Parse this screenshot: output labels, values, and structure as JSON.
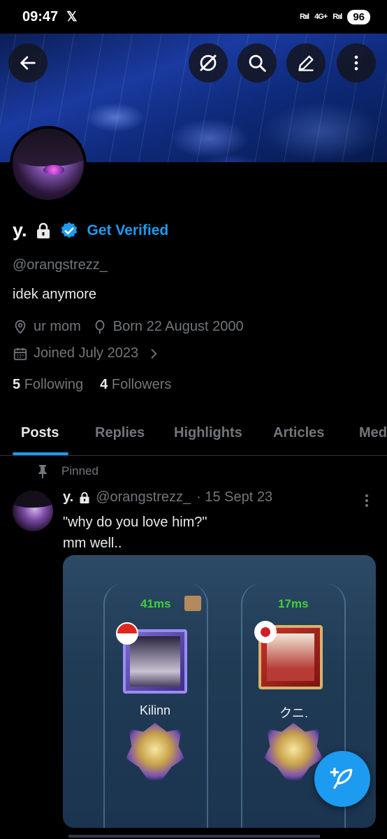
{
  "status_bar": {
    "time": "09:47",
    "notification_icon": "x-logo-icon",
    "signal_left": "Rııl",
    "network": "4G+",
    "signal_right": "Rııl",
    "battery": "96"
  },
  "top_bar": {
    "back_icon": "arrow-left-icon",
    "grok_icon": "grok-icon",
    "search_icon": "search-icon",
    "edit_icon": "pencil-icon",
    "more_icon": "more-vertical-icon"
  },
  "profile": {
    "display_name": "y.",
    "locked_icon": "lock-icon",
    "verified_icon": "verified-badge-icon",
    "get_verified_label": "Get Verified",
    "handle": "@orangstrezz_",
    "bio": "idek anymore",
    "location": "ur mom",
    "born": "Born 22 August 2000",
    "joined": "Joined July 2023",
    "following_count": "5",
    "following_label": "Following",
    "followers_count": "4",
    "followers_label": "Followers"
  },
  "tabs": [
    {
      "label": "Posts",
      "active": true
    },
    {
      "label": "Replies",
      "active": false
    },
    {
      "label": "Highlights",
      "active": false
    },
    {
      "label": "Articles",
      "active": false
    },
    {
      "label": "Med",
      "active": false
    }
  ],
  "pinned_post": {
    "pinned_label": "Pinned",
    "author_name": "y.",
    "author_handle": "@orangstrezz_",
    "date": "· 15 Sept 23",
    "text_line1": "\"why do you love him?\"",
    "text_line2": "mm well..",
    "media": {
      "left_ping": "41ms",
      "left_player": "Kilinn",
      "right_ping": "17ms",
      "right_player": "クニ."
    }
  },
  "fab": {
    "icon": "compose-feather-icon"
  },
  "colors": {
    "accent": "#1d9bf0",
    "secondary_text": "#71767b",
    "primary_text": "#e7e9ea",
    "background": "#000000"
  }
}
